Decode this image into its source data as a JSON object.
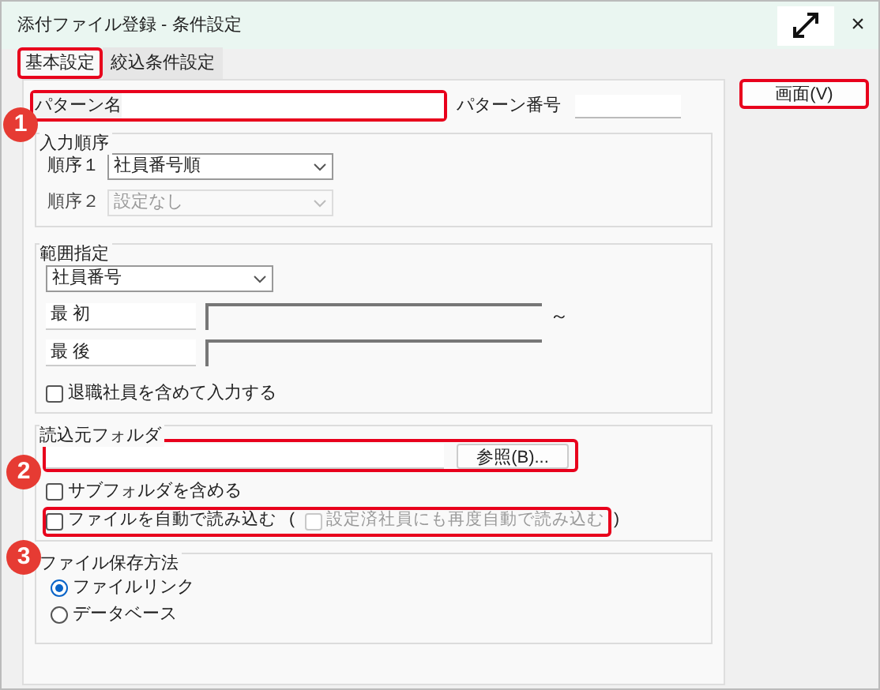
{
  "window": {
    "title": "添付ファイル登録 - 条件設定",
    "close": "×"
  },
  "tabs": [
    {
      "label": "基本設定",
      "selected": true,
      "highlighted": true
    },
    {
      "label": "絞込条件設定",
      "selected": false,
      "highlighted": false
    }
  ],
  "pattern": {
    "name_label": "パターン名",
    "number_label": "パターン番号",
    "highlighted": true
  },
  "input_order": {
    "title": "入力順序",
    "rows": [
      {
        "label": "順序１",
        "value": "社員番号順",
        "disabled": false
      },
      {
        "label": "順序２",
        "value": "設定なし",
        "disabled": true
      }
    ]
  },
  "range": {
    "title": "範囲指定",
    "field": "社員番号",
    "start_label": "最 初",
    "end_label": "最 後",
    "separator": "～",
    "include_retired": {
      "label": "退職社員を含めて入力する",
      "checked": false
    }
  },
  "folder": {
    "title": "読込元フォルダ",
    "browse": "参照(B)...",
    "highlighted": true,
    "include_subfolders": {
      "label": "サブフォルダを含める",
      "checked": false
    },
    "auto_load": {
      "label": "ファイルを自動で読み込む",
      "checked": false,
      "open": "(",
      "close": ")",
      "highlighted": true,
      "reload": {
        "label": "設定済社員にも再度自動で読み込む",
        "checked": false,
        "disabled": true
      }
    }
  },
  "storage": {
    "title": "ファイル保存方法",
    "options": [
      {
        "label": "ファイルリンク",
        "selected": true
      },
      {
        "label": "データベース",
        "selected": false
      }
    ]
  },
  "screen_button": {
    "label": "画面(V)",
    "highlighted": true
  },
  "callouts": [
    "1",
    "2",
    "3"
  ]
}
